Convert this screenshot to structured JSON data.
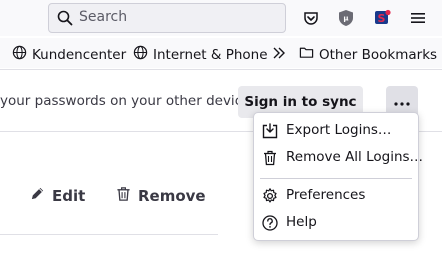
{
  "toolbar": {
    "search_placeholder": "Search",
    "icons": [
      "pocket-icon",
      "ublock-icon",
      "extension-icon",
      "hamburger-menu-icon"
    ]
  },
  "bookmarks": [
    {
      "label": "Kundencenter",
      "icon": "globe-icon"
    },
    {
      "label": "Internet & Phone",
      "icon": "globe-icon"
    },
    {
      "label": "Other Bookmarks",
      "icon": "folder-icon"
    }
  ],
  "sync": {
    "text": "your passwords on your other devices",
    "button_label": "Sign in to sync"
  },
  "actions": {
    "edit_label": "Edit",
    "remove_label": "Remove"
  },
  "menu": {
    "items": [
      {
        "label": "Export Logins…",
        "icon": "export-icon"
      },
      {
        "label": "Remove All Logins…",
        "icon": "trash-icon"
      },
      {
        "label": "Preferences",
        "icon": "gear-icon"
      },
      {
        "label": "Help",
        "icon": "help-icon"
      }
    ]
  },
  "colors": {
    "accent": "#e22850",
    "toolbar_bg": "#f9f9fb",
    "button_bg": "#e9e9ed"
  }
}
